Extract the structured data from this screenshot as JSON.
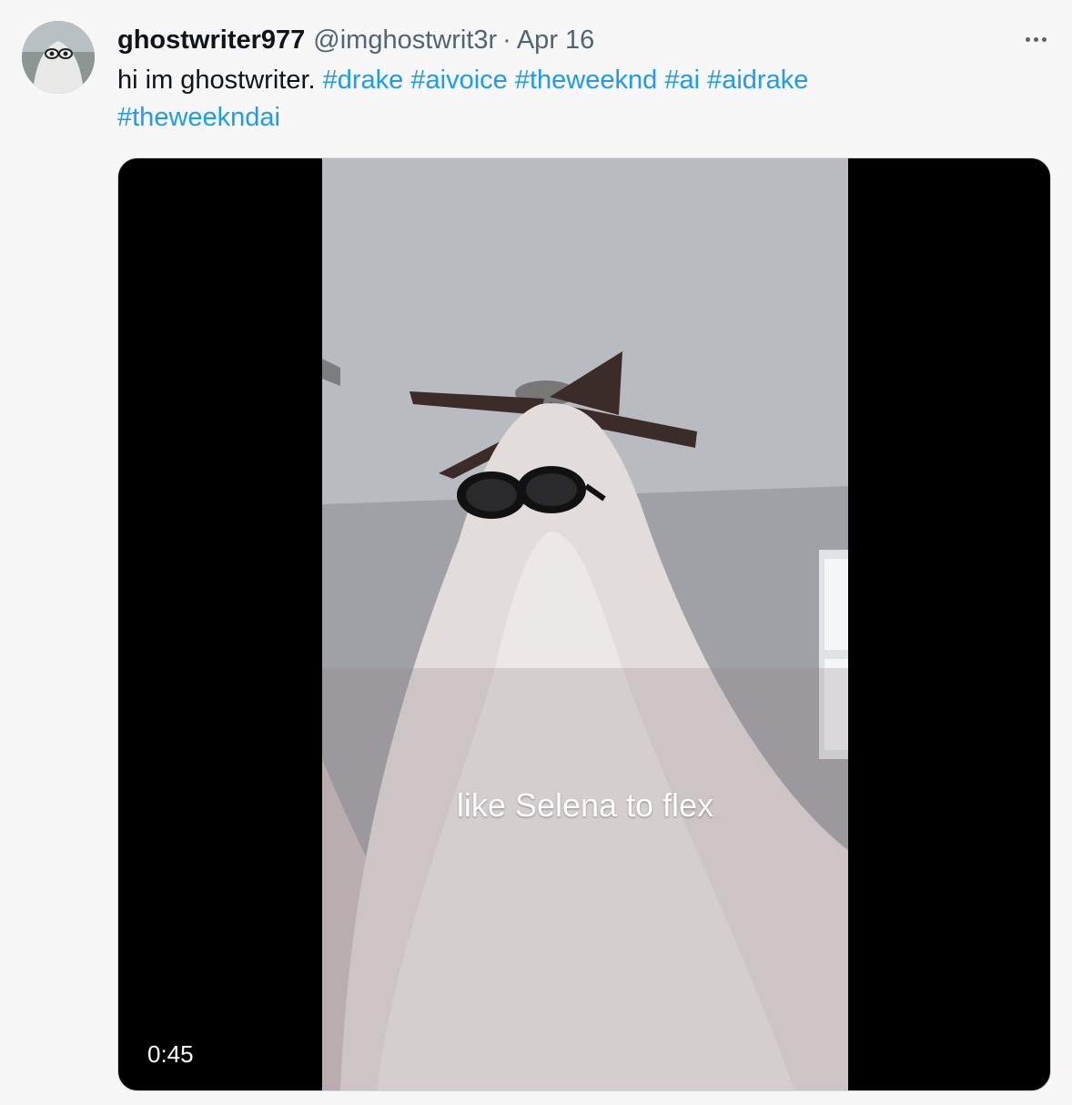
{
  "tweet": {
    "display_name": "ghostwriter977",
    "handle": "@imghostwrit3r",
    "separator": "·",
    "date": "Apr 16",
    "text_plain": "hi im ghostwriter.",
    "hashtags": [
      "#drake",
      "#aivoice",
      "#theweeknd",
      "#ai",
      "#aidrake",
      "#theweekndai"
    ]
  },
  "media": {
    "caption": "like Selena to flex",
    "duration": "0:45"
  },
  "icons": {
    "more": "more-horizontal-icon",
    "avatar": "ghost-avatar"
  },
  "colors": {
    "background": "#f7f7f7",
    "link": "#1d9bf0",
    "secondary_text": "#536471",
    "primary_text": "#0f1419"
  }
}
